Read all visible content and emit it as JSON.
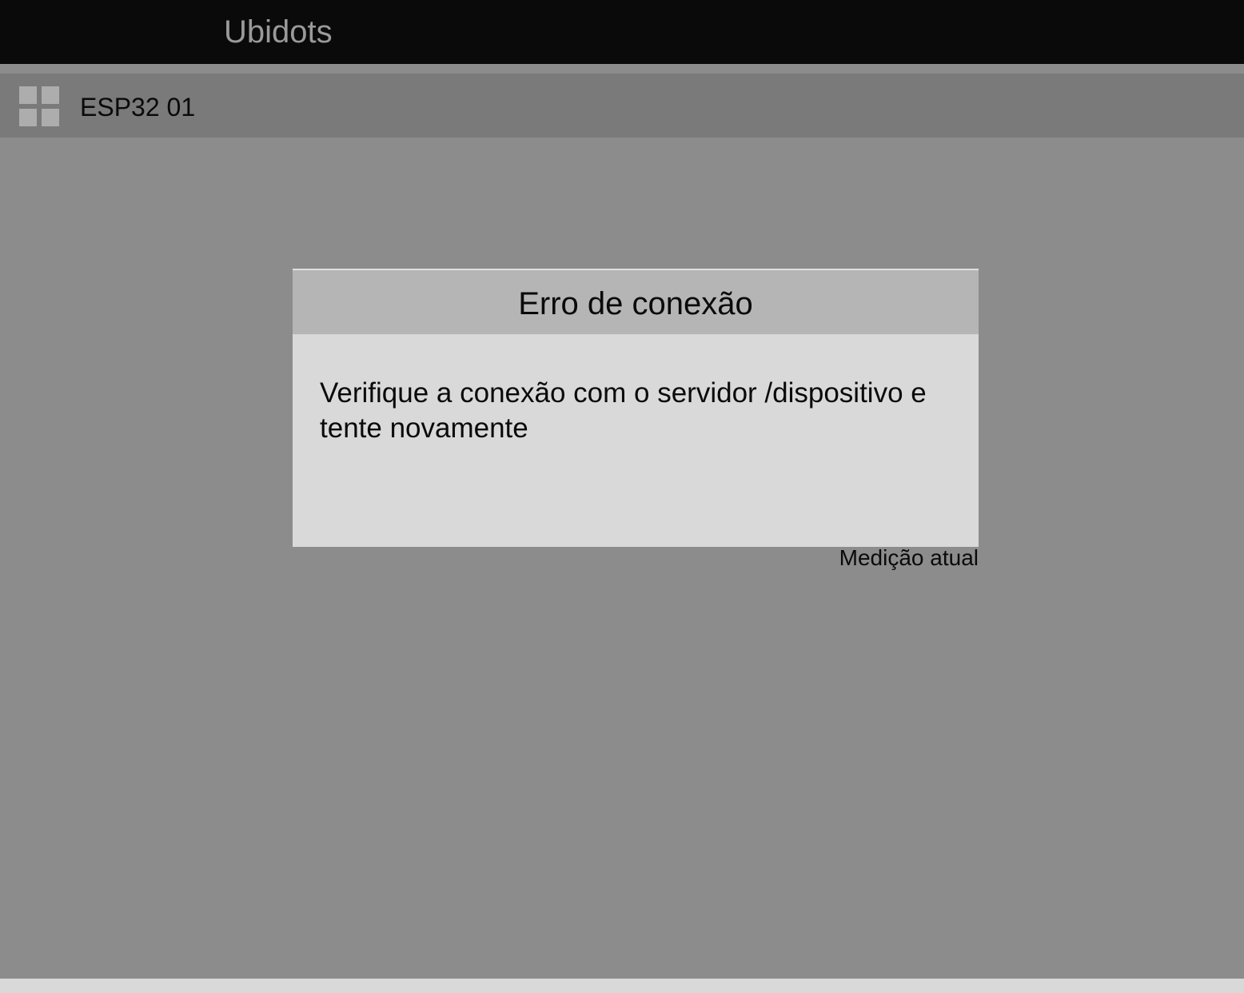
{
  "app": {
    "title": "Ubidots"
  },
  "device_bar": {
    "menu_icon": "grid-icon",
    "device_name": "ESP32 01"
  },
  "dialog": {
    "title": "Erro de conexão",
    "message": "Verifique a conexão com o servidor /dispositivo e tente novamente"
  },
  "dashboard": {
    "current_reading_label": "Medição atual"
  },
  "colors": {
    "topbar": "#0a0a0a",
    "app_title": "#9a9a9a",
    "background": "#8c8c8c",
    "device_bar": "#7a7a7a",
    "dialog_header": "#b5b5b5",
    "dialog_body": "#d9d9d9",
    "text": "#0a0a0a"
  }
}
